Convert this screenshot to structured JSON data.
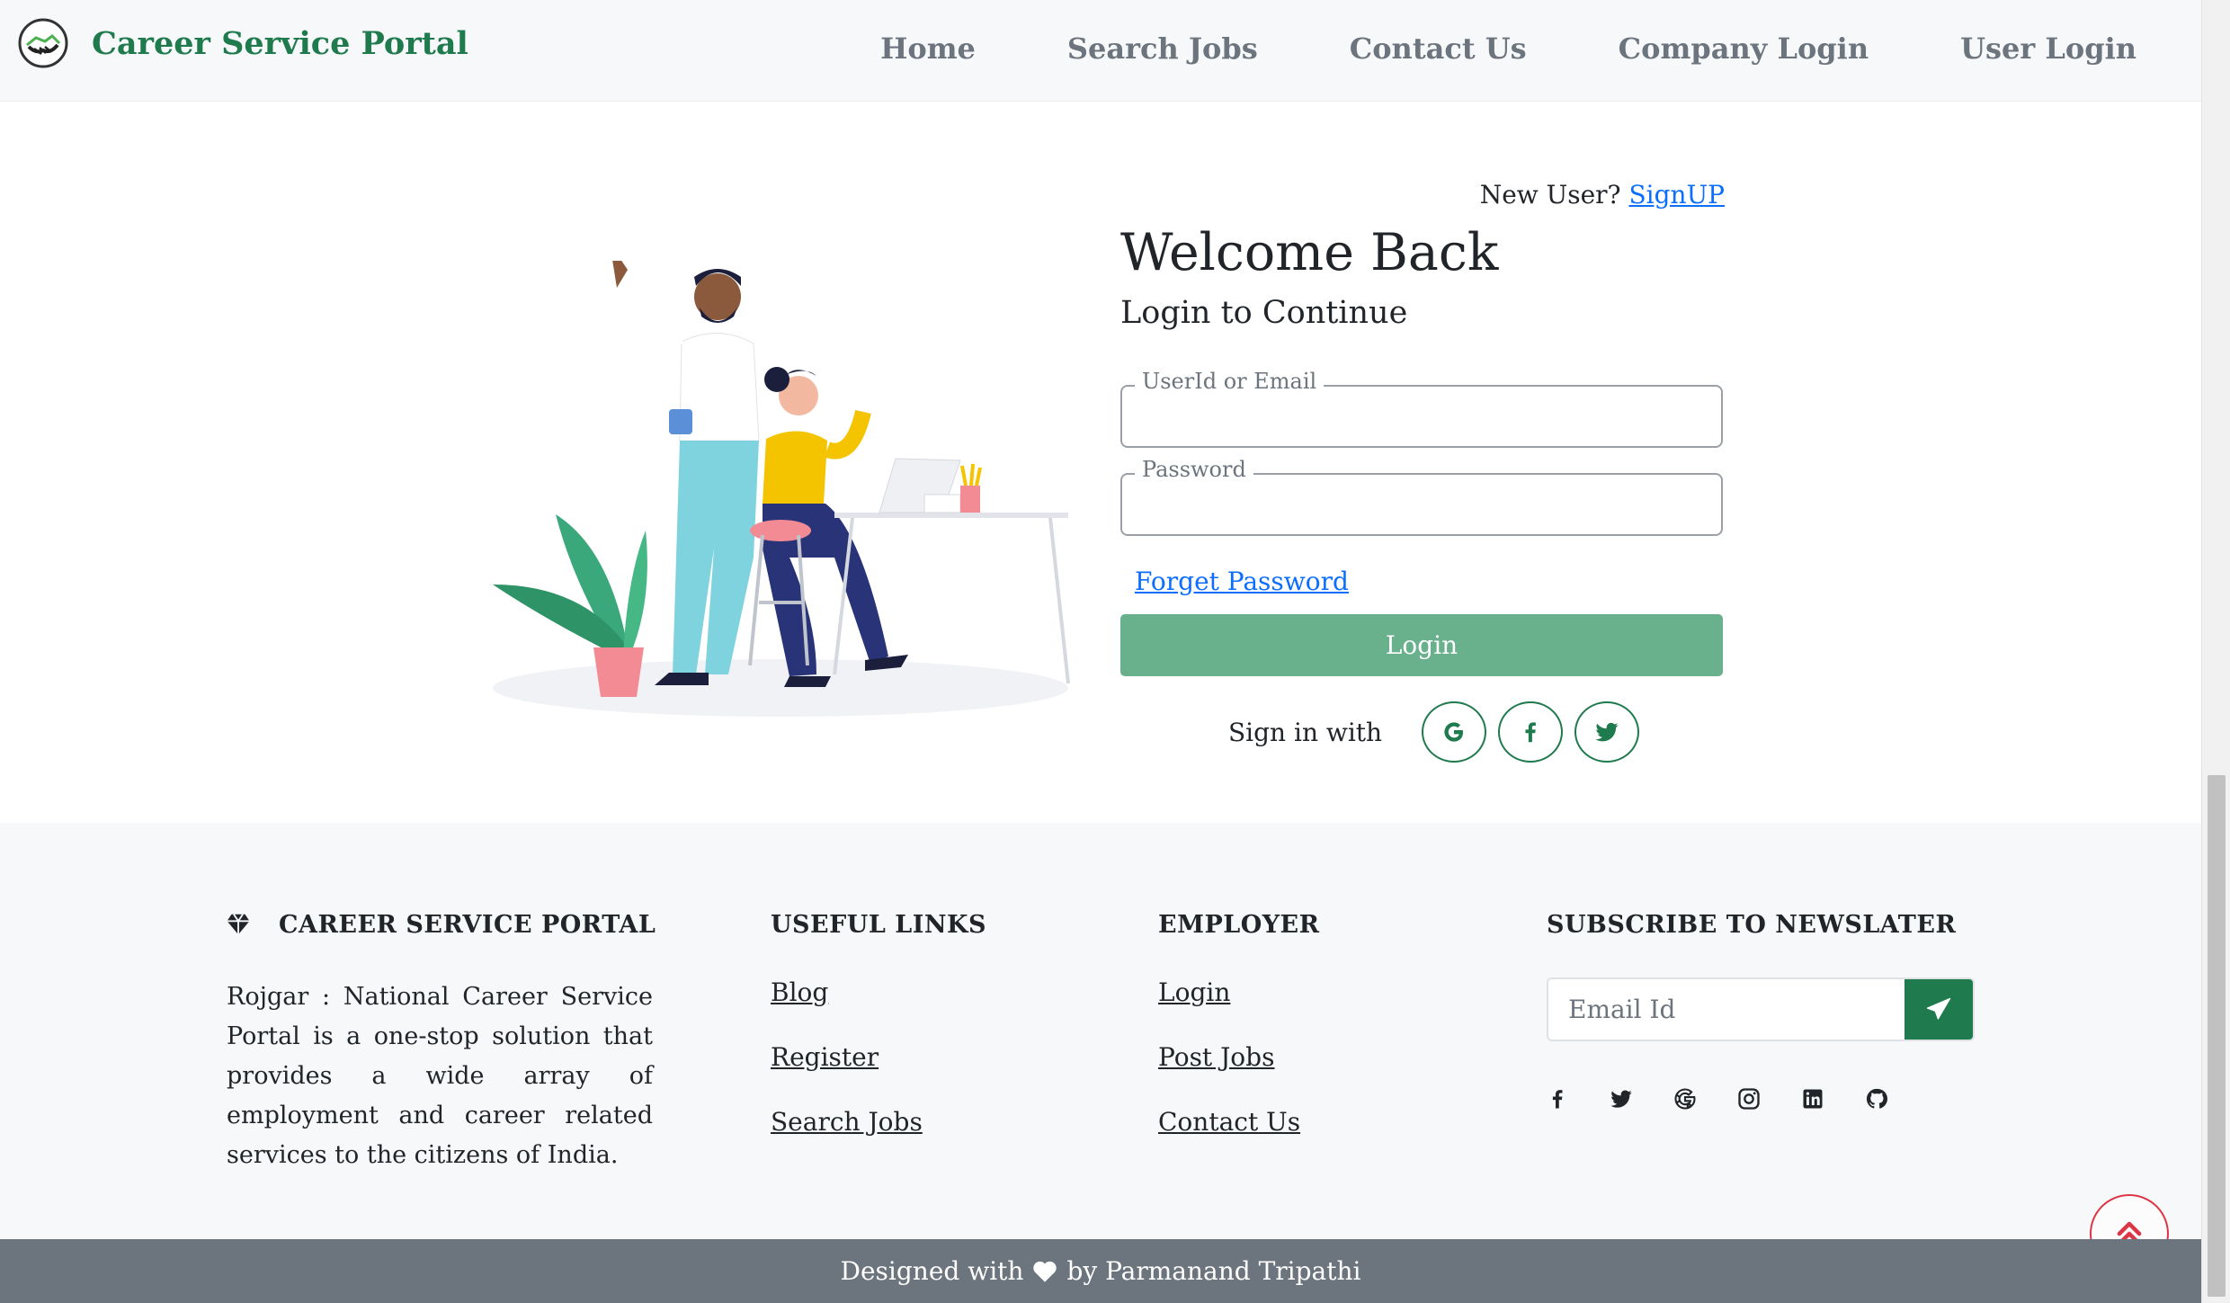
{
  "navbar": {
    "brand": "Career Service Portal",
    "links": [
      "Home",
      "Search Jobs",
      "Contact Us",
      "Company Login",
      "User Login"
    ]
  },
  "login": {
    "new_user_text": "New User?",
    "signup_link": "SignUP",
    "title": "Welcome Back",
    "subtitle": "Login to Continue",
    "user_field_label": "UserId or Email",
    "password_field_label": "Password",
    "forget_password": "Forget Password",
    "login_button": "Login",
    "sign_in_with": "Sign in with",
    "social_icons": [
      "google-icon",
      "facebook-icon",
      "twitter-icon"
    ]
  },
  "footer": {
    "brand_heading": "CAREER SERVICE PORTAL",
    "about": "Rojgar : National Career Service Portal is a one-stop solution that provides a wide array of employment and career related services to the citizens of India.",
    "useful_links_heading": "USEFUL LINKS",
    "useful_links": [
      "Blog",
      "Register",
      "Search Jobs"
    ],
    "employer_heading": "EMPLOYER",
    "employer_links": [
      "Login",
      "Post Jobs",
      "Contact Us"
    ],
    "newsletter_heading": "SUBSCRIBE TO NEWSLATER",
    "newsletter_placeholder": "Email Id",
    "social_icons": [
      "facebook-icon",
      "twitter-icon",
      "google-icon",
      "instagram-icon",
      "linkedin-icon",
      "github-icon"
    ]
  },
  "bottom_bar": {
    "prefix": "Designed with",
    "suffix": "by Parmanand Tripathi"
  },
  "colors": {
    "brand_green": "#1f7a4d",
    "login_button": "#69b08c",
    "link_blue": "#0d6efd",
    "bottom_bar": "#6c757d",
    "scroll_top": "#dc3545"
  }
}
